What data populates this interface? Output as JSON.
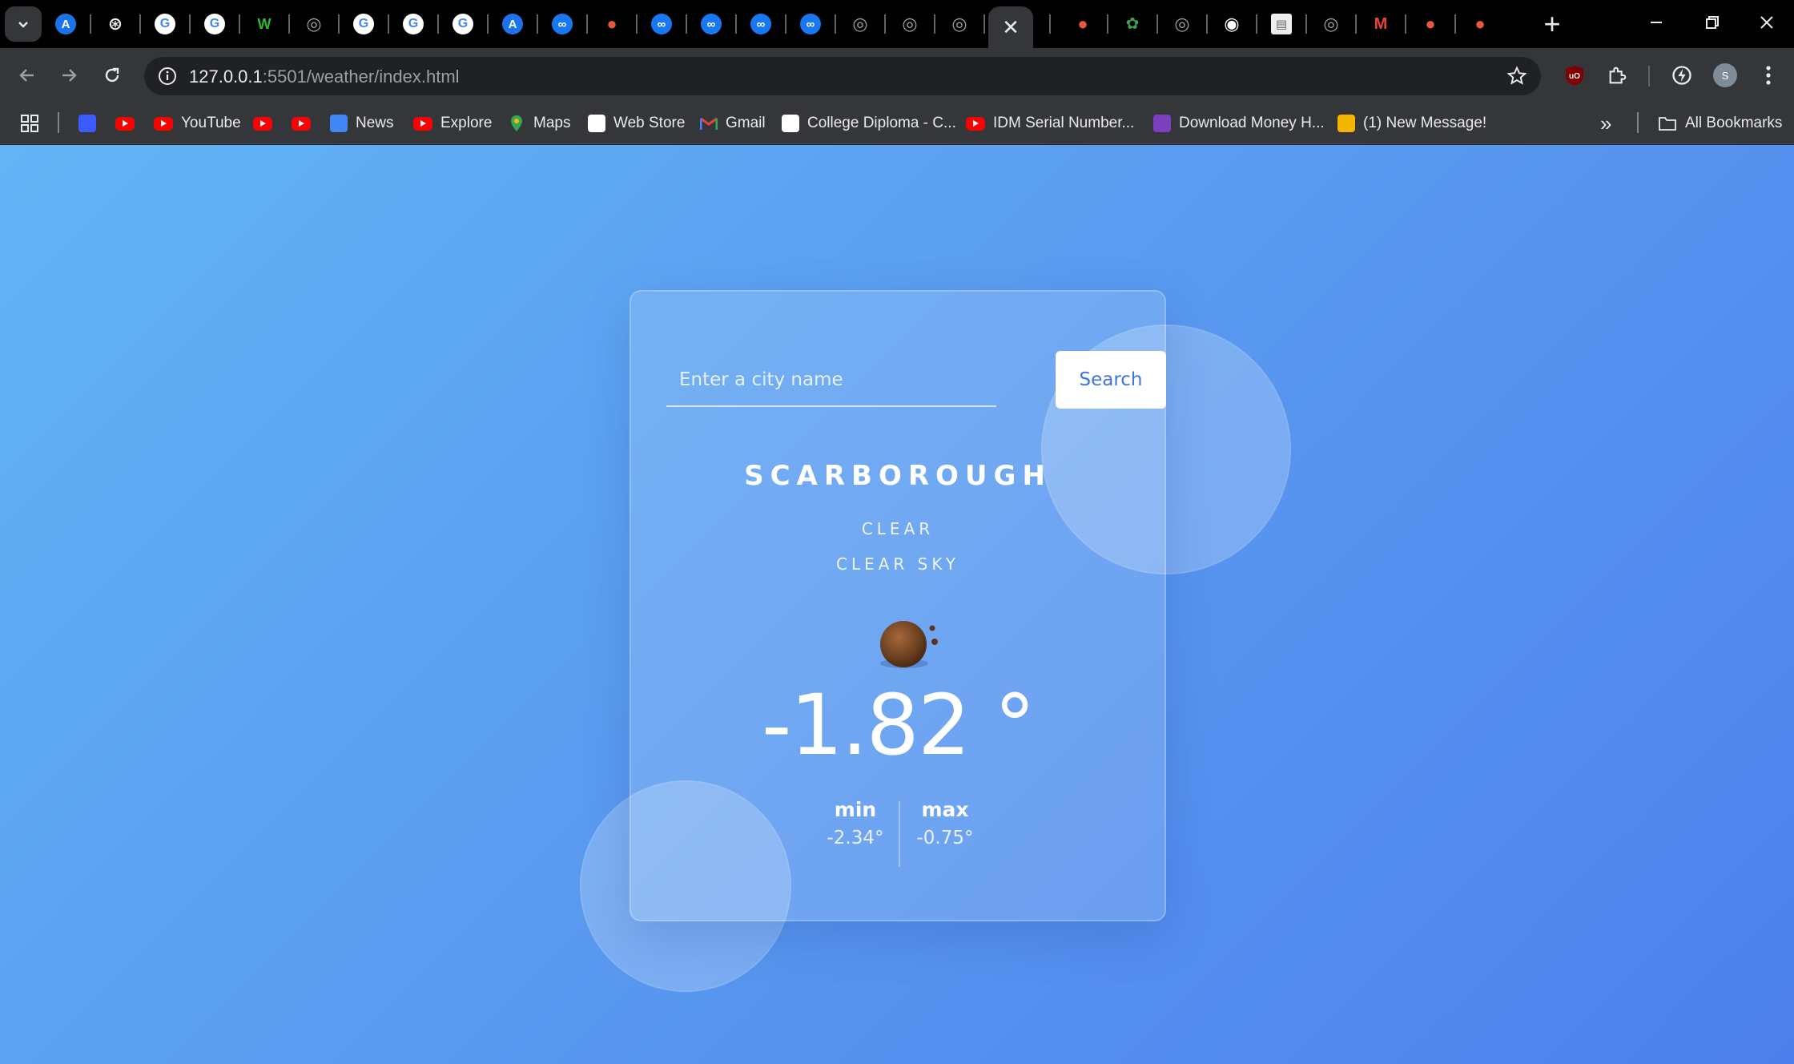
{
  "browser": {
    "tabs": [
      {
        "icon": "expand-tabs-icon"
      },
      {
        "icon": "analytics-icon",
        "color": "#1a73e8",
        "glyph": "A"
      },
      {
        "icon": "openai-icon",
        "color": "#000000",
        "glyph": "⊛"
      },
      {
        "icon": "google-icon",
        "color": "#ffffff",
        "glyph": "G"
      },
      {
        "icon": "google-icon",
        "color": "#ffffff",
        "glyph": "G"
      },
      {
        "icon": "wix-icon",
        "color": "#0a0a0a",
        "glyph": "W"
      },
      {
        "icon": "globe-icon",
        "color": "#9aa0a6",
        "glyph": "◎"
      },
      {
        "icon": "google-icon",
        "color": "#ffffff",
        "glyph": "G"
      },
      {
        "icon": "google-icon",
        "color": "#ffffff",
        "glyph": "G"
      },
      {
        "icon": "google-icon",
        "color": "#ffffff",
        "glyph": "G"
      },
      {
        "icon": "analytics-icon",
        "color": "#1a73e8",
        "glyph": "A"
      },
      {
        "icon": "meta-icon",
        "color": "#1877f2",
        "glyph": "∞"
      },
      {
        "icon": "hat-icon",
        "color": "#e8593b",
        "glyph": "●"
      },
      {
        "icon": "meta-icon",
        "color": "#1877f2",
        "glyph": "∞"
      },
      {
        "icon": "meta-icon",
        "color": "#1877f2",
        "glyph": "∞"
      },
      {
        "icon": "meta-icon",
        "color": "#1877f2",
        "glyph": "∞"
      },
      {
        "icon": "meta-icon",
        "color": "#1877f2",
        "glyph": "∞"
      },
      {
        "icon": "globe-icon",
        "color": "#9aa0a6",
        "glyph": "◎"
      },
      {
        "icon": "globe-icon",
        "color": "#9aa0a6",
        "glyph": "◎"
      },
      {
        "icon": "globe-icon",
        "color": "#9aa0a6",
        "glyph": "◎"
      },
      {
        "icon": "globe-icon",
        "color": "#9aa0a6",
        "glyph": "◎"
      },
      {
        "icon": "hat-icon",
        "color": "#e8593b",
        "glyph": "●"
      },
      {
        "icon": "plant-icon",
        "color": "#2e7d32",
        "glyph": "✿"
      },
      {
        "icon": "globe-icon",
        "color": "#9aa0a6",
        "glyph": "◎"
      },
      {
        "icon": "chrome-icon",
        "color": "#ffffff",
        "glyph": "◉"
      },
      {
        "icon": "document-icon",
        "color": "#eeeeee",
        "glyph": "▤"
      },
      {
        "icon": "globe-icon",
        "color": "#9aa0a6",
        "glyph": "◎"
      },
      {
        "icon": "gmail-icon",
        "color": "#ea4335",
        "glyph": "M"
      },
      {
        "icon": "hat-icon",
        "color": "#e8593b",
        "glyph": "●"
      },
      {
        "icon": "hat-icon",
        "color": "#e8593b",
        "glyph": "●"
      }
    ],
    "active_tab_close": "✕",
    "new_tab": "+",
    "url_host": "127.0.0.1",
    "url_rest": ":5501/weather/index.html",
    "bookmarks": [
      {
        "label": "",
        "icon": "apps-grid-icon"
      },
      {
        "label": "",
        "icon": "arrow-bookmark-icon"
      },
      {
        "label": "",
        "icon": "youtube-icon"
      },
      {
        "label": "YouTube",
        "icon": "youtube-icon"
      },
      {
        "label": "",
        "icon": "youtube-icon"
      },
      {
        "label": "",
        "icon": "youtube-icon"
      },
      {
        "label": "News",
        "icon": "google-news-icon"
      },
      {
        "label": "Explore",
        "icon": "youtube-icon"
      },
      {
        "label": "Maps",
        "icon": "maps-icon"
      },
      {
        "label": "Web Store",
        "icon": "web-store-icon"
      },
      {
        "label": "Gmail",
        "icon": "gmail-icon"
      },
      {
        "label": "College Diploma - C...",
        "icon": "diploma-icon"
      },
      {
        "label": "IDM Serial Number...",
        "icon": "youtube-icon"
      },
      {
        "label": "Download Money H...",
        "icon": "money-icon"
      },
      {
        "label": "(1) New Message!",
        "icon": "message-icon"
      }
    ],
    "bookmarks_overflow": "»",
    "all_bookmarks": "All Bookmarks",
    "profile_initial": "S",
    "colors": {
      "page_gradient_start": "#62b4f5",
      "page_gradient_end": "#4d80ec",
      "accent_button_text": "#3f74e0"
    }
  },
  "weather": {
    "search_placeholder": "Enter a city name",
    "search_value": "",
    "search_button": "Search",
    "city": "SCARBOROUGH",
    "condition_main": "CLEAR",
    "condition_desc": "CLEAR SKY",
    "icon": "clear-night-icon",
    "temperature": "-1.82 °",
    "min_label": "min",
    "min_value": "-2.34°",
    "max_label": "max",
    "max_value": "-0.75°"
  }
}
